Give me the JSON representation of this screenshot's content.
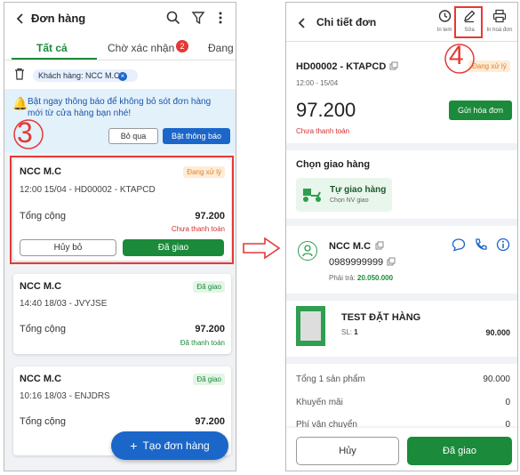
{
  "left": {
    "title": "Đơn hàng",
    "tabs": [
      {
        "label": "Tất cả"
      },
      {
        "label": "Chờ xác nhận",
        "badge": "2"
      },
      {
        "label": "Đang x"
      }
    ],
    "filter_chip": "Khách hàng: NCC M.C",
    "notice": {
      "text": "Bật ngay thông báo để không bỏ sót đơn hàng mới từ cửa hàng bạn nhé!",
      "skip": "Bỏ qua",
      "enable": "Bật thông báo"
    },
    "step_label": "3",
    "orders": [
      {
        "name": "NCC M.C",
        "status": "Đang xử lý",
        "info": "12:00 15/04 - HD00002 - KTAPCD",
        "total_label": "Tổng cộng",
        "total": "97.200",
        "payment": "Chưa thanh toán",
        "cancel": "Hủy bỏ",
        "delivered": "Đã giao"
      },
      {
        "name": "NCC M.C",
        "status": "Đã giao",
        "info": "14:40 18/03 - JVYJSE",
        "total_label": "Tổng cộng",
        "total": "97.200",
        "payment": "Đã thanh toán"
      },
      {
        "name": "NCC M.C",
        "status": "Đã giao",
        "info": "10:16 18/03 - ENJDRS",
        "total_label": "Tổng cộng",
        "total": "97.200"
      }
    ],
    "create_button": "Tạo đơn hàng"
  },
  "right": {
    "title": "Chi tiết đơn",
    "actions": {
      "history": "In tem",
      "edit": "Sửa",
      "print": "In hoá đơn"
    },
    "step_label": "4",
    "order_code": "HD00002 - KTAPCD",
    "status": "Đang xử lý",
    "datetime": "12:00 - 15/04",
    "amount": "97.200",
    "payment_status": "Chưa thanh toán",
    "send_invoice": "Gửi hóa đơn",
    "delivery_heading": "Chọn giao hàng",
    "delivery_option": {
      "title": "Tự giao hàng",
      "subtitle": "Chọn NV giao"
    },
    "customer": {
      "name": "NCC M.C",
      "phone": "0989999999",
      "due_label": "Phải trả:",
      "due_value": "20.050.000"
    },
    "product": {
      "name": "TEST ĐẶT HÀNG",
      "qty_label": "SL:",
      "qty": "1",
      "price": "90.000"
    },
    "summary": [
      {
        "label": "Tổng 1 sản phẩm",
        "value": "90.000"
      },
      {
        "label": "Khuyến mãi",
        "value": "0"
      },
      {
        "label": "Phí vận chuyển",
        "value": "0"
      }
    ],
    "cancel": "Hủy",
    "delivered": "Đã giao"
  },
  "colors": {
    "green": "#1b8a3a",
    "red": "#e53935",
    "blue": "#1b66c9"
  }
}
